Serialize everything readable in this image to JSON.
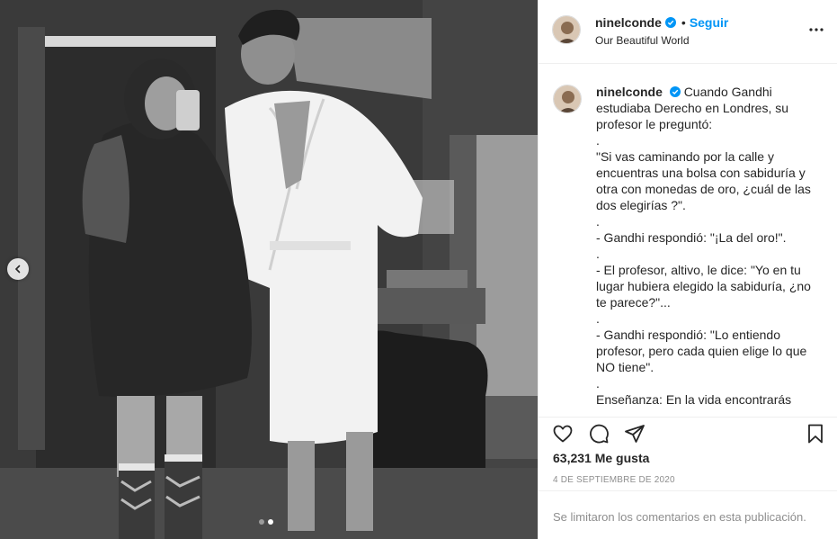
{
  "post": {
    "username": "ninelconde",
    "follow_label": "Seguir",
    "separator": "•",
    "location": "Our Beautiful World",
    "caption_lines": [
      "Cuando Gandhi estudiaba Derecho en Londres, su profesor le preguntó:",
      ".",
      "\"Si vas caminando por la calle y encuentras una bolsa con sabiduría y otra con monedas de oro, ¿cuál de las dos elegirías ?\".",
      ".",
      "- Gandhi respondió: \"¡La del oro!\".",
      ".",
      "- El profesor, altivo, le dice: \"Yo en tu lugar hubiera elegido la sabiduría, ¿no te parece?\"...",
      ".",
      "- Gandhi respondió: \"Lo entiendo profesor, pero cada quien elige lo que NO tiene\".",
      ".",
      "Enseñanza: En la vida encontrarás"
    ],
    "likes": "63,231 Me gusta",
    "date": "4 DE SEPTIEMBRE DE 2020",
    "comments_notice": "Se limitaron los comentarios en esta publicación."
  },
  "carousel": {
    "total": 2,
    "active_index": 1
  },
  "icons": {
    "verified": "verified-badge-icon",
    "more": "more-options-icon",
    "like": "heart-icon",
    "comment": "comment-icon",
    "share": "send-icon",
    "save": "bookmark-icon",
    "prev": "chevron-left-icon"
  },
  "colors": {
    "accent": "#0095f6",
    "text": "#262626",
    "muted": "#8e8e8e",
    "border": "#efefef"
  }
}
